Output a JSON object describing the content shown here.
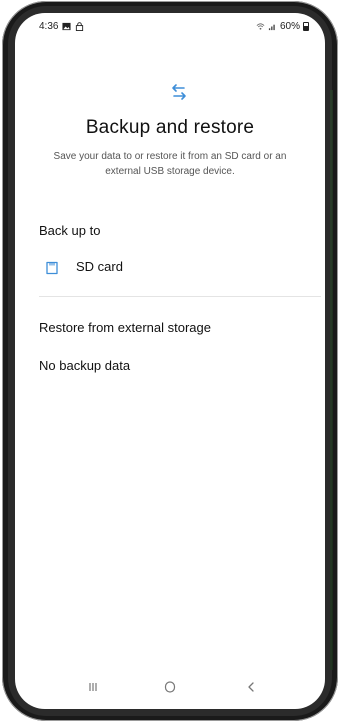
{
  "status_bar": {
    "time": "4:36",
    "battery": "60%"
  },
  "header": {
    "title": "Backup and restore",
    "subtitle": "Save your data to or restore it from an SD card or an external USB storage device."
  },
  "backup": {
    "heading": "Back up to",
    "sd_card_label": "SD card"
  },
  "restore": {
    "heading": "Restore from external storage",
    "status": "No backup data"
  },
  "icons": {
    "header": "swap-arrows-icon",
    "sd_card": "sd-card-icon",
    "nav_recents": "recents-icon",
    "nav_home": "home-icon",
    "nav_back": "back-icon"
  },
  "colors": {
    "accent": "#3e8ed8",
    "text": "#111111",
    "muted": "#555555"
  }
}
